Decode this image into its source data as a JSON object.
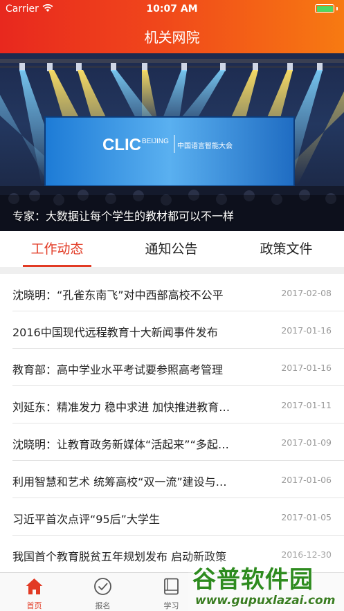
{
  "status_bar": {
    "carrier": "Carrier",
    "time": "10:07 AM"
  },
  "header": {
    "title": "机关网院"
  },
  "banner": {
    "caption": "专家：大数据让每个学生的教材都可以不一样",
    "screen_text": {
      "clic": "CLIC",
      "beijing": "BEIJING",
      "conference": "中国语言智能大会"
    }
  },
  "tabs": [
    {
      "label": "工作动态",
      "active": true
    },
    {
      "label": "通知公告",
      "active": false
    },
    {
      "label": "政策文件",
      "active": false
    }
  ],
  "news": [
    {
      "title": "沈晓明：“孔雀东南飞”对中西部高校不公平",
      "date": "2017-02-08"
    },
    {
      "title": "2016中国现代远程教育十大新闻事件发布",
      "date": "2017-01-16"
    },
    {
      "title": "教育部：高中学业水平考试要参照高考管理",
      "date": "2017-01-16"
    },
    {
      "title": "刘延东：精准发力 稳中求进 加快推进教育…",
      "date": "2017-01-11"
    },
    {
      "title": "沈晓明：让教育政务新媒体“活起来”“多起…",
      "date": "2017-01-09"
    },
    {
      "title": "利用智慧和艺术 统筹高校“双一流”建设与…",
      "date": "2017-01-06"
    },
    {
      "title": "习近平首次点评“95后”大学生",
      "date": "2017-01-05"
    },
    {
      "title": "我国首个教育脱贫五年规划发布 启动新政策",
      "date": "2016-12-30"
    }
  ],
  "tabbar": [
    {
      "label": "首页",
      "icon": "home-icon",
      "active": true
    },
    {
      "label": "报名",
      "icon": "check-circle-icon",
      "active": false
    },
    {
      "label": "学习",
      "icon": "book-icon",
      "active": false
    }
  ],
  "watermark": {
    "main": "谷普软件园",
    "sub": "www.gupuxlazai.com"
  },
  "colors": {
    "accent": "#e23a24",
    "header_start": "#e8281e",
    "header_end": "#f77a12"
  }
}
